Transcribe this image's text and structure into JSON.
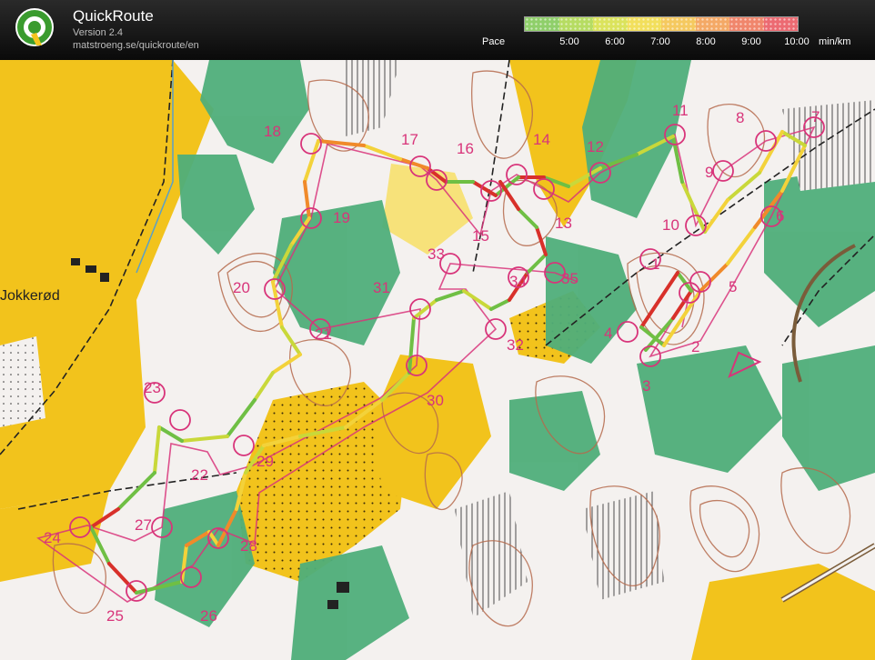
{
  "app": {
    "title": "QuickRoute",
    "version": "Version 2.4",
    "url": "matstroeng.se/quickroute/en",
    "logo_letter": "Q"
  },
  "legend": {
    "label": "Pace",
    "ticks": [
      "5:00",
      "6:00",
      "7:00",
      "8:00",
      "9:00",
      "10:00"
    ],
    "unit": "min/km",
    "colors": [
      "#8fcf6a",
      "#b6dc62",
      "#dbe35c",
      "#f2df5c",
      "#f5c95f",
      "#f4a966",
      "#f0866c",
      "#ec6a72"
    ]
  },
  "map": {
    "place_name": "Jokkerød",
    "controls": [
      {
        "n": "1"
      },
      {
        "n": "2"
      },
      {
        "n": "3"
      },
      {
        "n": "4"
      },
      {
        "n": "5"
      },
      {
        "n": "6"
      },
      {
        "n": "7"
      },
      {
        "n": "8"
      },
      {
        "n": "9"
      },
      {
        "n": "10"
      },
      {
        "n": "11"
      },
      {
        "n": "12"
      },
      {
        "n": "13"
      },
      {
        "n": "14"
      },
      {
        "n": "15"
      },
      {
        "n": "16"
      },
      {
        "n": "17"
      },
      {
        "n": "18"
      },
      {
        "n": "19"
      },
      {
        "n": "20"
      },
      {
        "n": "21"
      },
      {
        "n": "22"
      },
      {
        "n": "23"
      },
      {
        "n": "24"
      },
      {
        "n": "25"
      },
      {
        "n": "26"
      },
      {
        "n": "27"
      },
      {
        "n": "28"
      },
      {
        "n": "29"
      },
      {
        "n": "30"
      },
      {
        "n": "31"
      },
      {
        "n": "32"
      },
      {
        "n": "33"
      },
      {
        "n": "34"
      },
      {
        "n": "35"
      }
    ],
    "colors": {
      "open_yellow": "#f2c31c",
      "rough_yellow": "#f7e27a",
      "forest_white": "#f4f1ef",
      "green": "#4fae7a",
      "course_magenta": "#d8347a",
      "contour_brown": "#b56a4c"
    }
  }
}
